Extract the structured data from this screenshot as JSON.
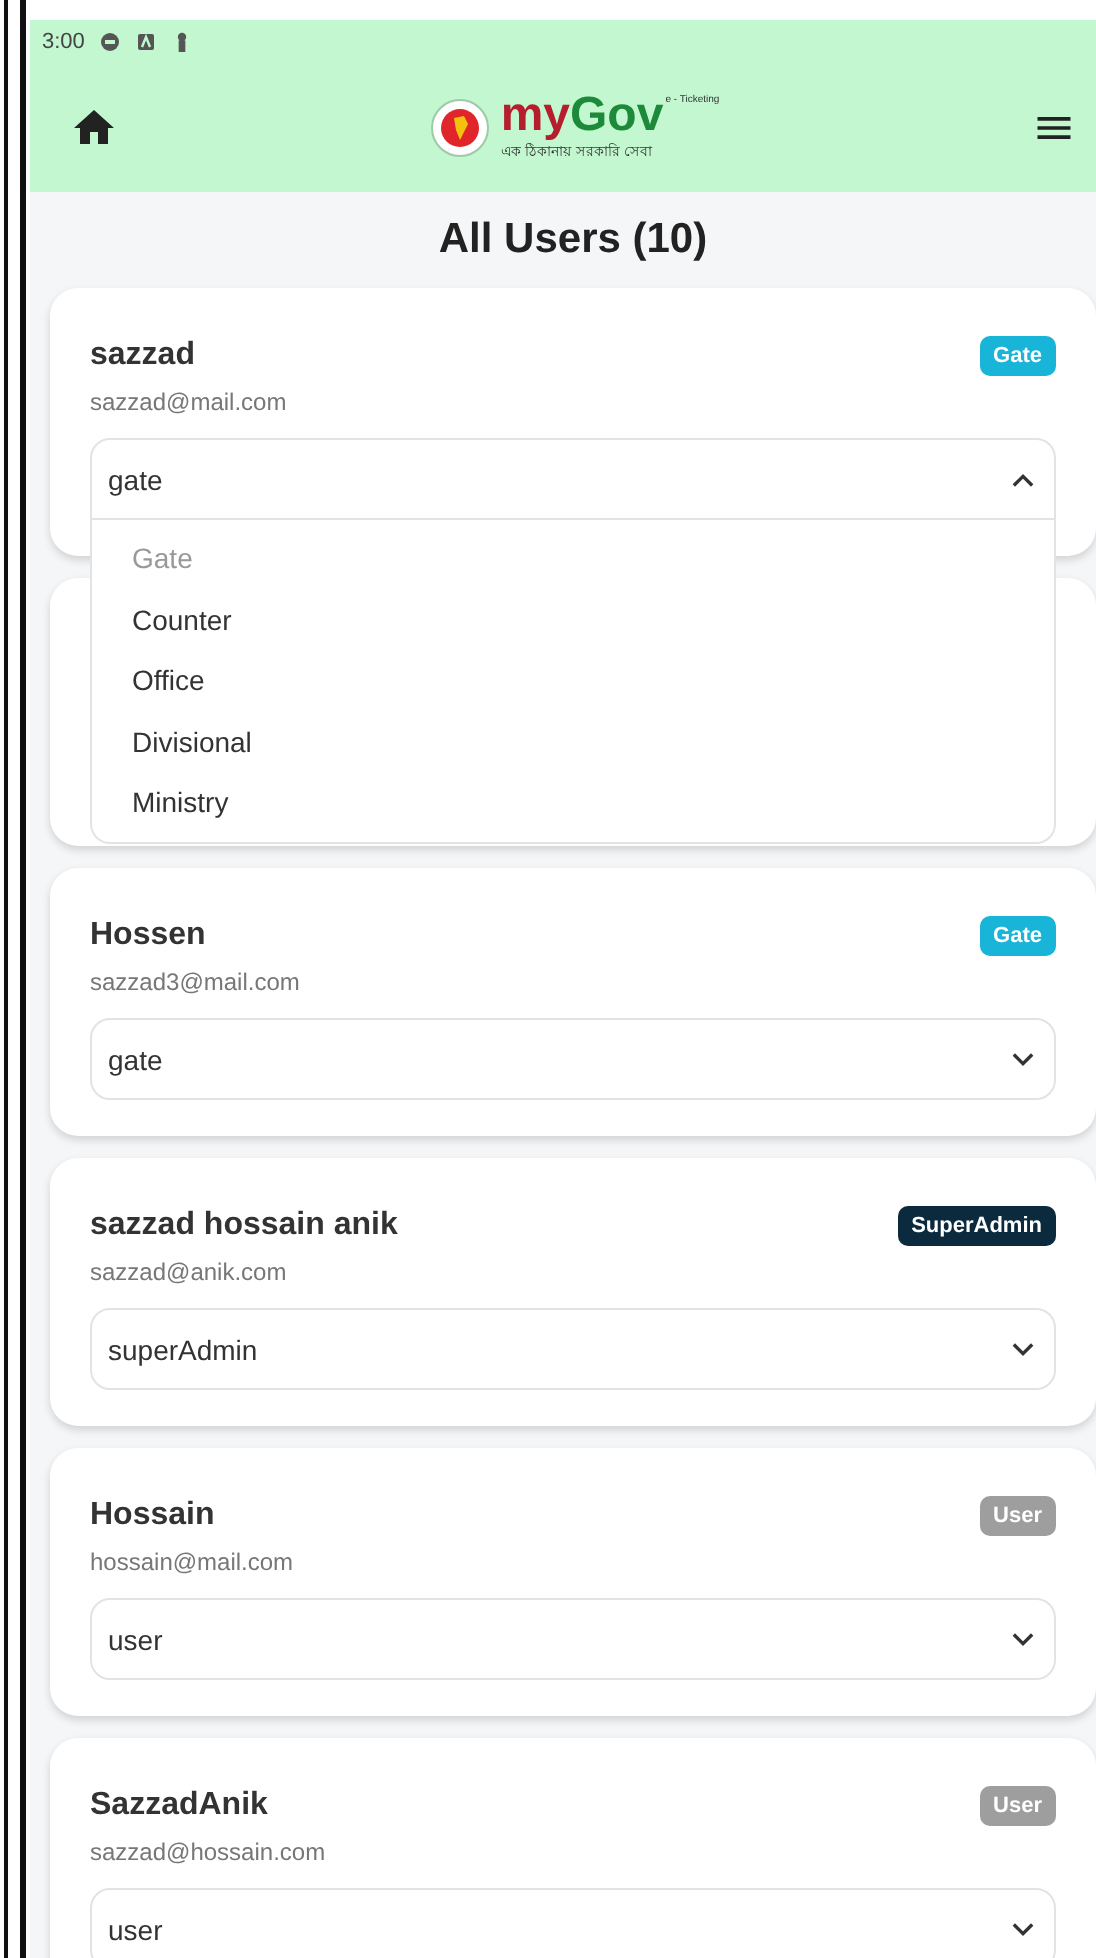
{
  "status_bar": {
    "time": "3:00"
  },
  "app_bar": {
    "logo": {
      "part1": "my",
      "part2": "Gov",
      "tag": "e - Ticketing",
      "tagline": "এক ঠিকানায় সরকারি সেবা"
    }
  },
  "title": "All Users (10)",
  "users": [
    {
      "kind": "user",
      "name": "sazzad",
      "email": "sazzad@mail.com",
      "badge": "Gate",
      "color": "#19b5d8",
      "role": "gate",
      "expanded": true,
      "options": [
        {
          "label": "Gate",
          "selected": true
        },
        {
          "label": "Counter",
          "selected": false
        },
        {
          "label": "Office",
          "selected": false
        },
        {
          "label": "Divisional",
          "selected": false
        },
        {
          "label": "Ministry",
          "selected": false
        }
      ]
    },
    {
      "kind": "covered"
    },
    {
      "kind": "user",
      "name": "Hossen",
      "email": "sazzad3@mail.com",
      "badge": "Gate",
      "color": "#19b5d8",
      "role": "gate",
      "expanded": false
    },
    {
      "kind": "user",
      "name": "sazzad hossain anik",
      "email": "sazzad@anik.com",
      "badge": "SuperAdmin",
      "color": "#0c2a3d",
      "role": "superAdmin",
      "expanded": false
    },
    {
      "kind": "user",
      "name": "Hossain",
      "email": "hossain@mail.com",
      "badge": "User",
      "color": "#9e9e9e",
      "role": "user",
      "expanded": false
    },
    {
      "kind": "user",
      "name": "SazzadAnik",
      "email": "sazzad@hossain.com",
      "badge": "User",
      "color": "#9e9e9e",
      "role": "user",
      "expanded": false
    }
  ]
}
